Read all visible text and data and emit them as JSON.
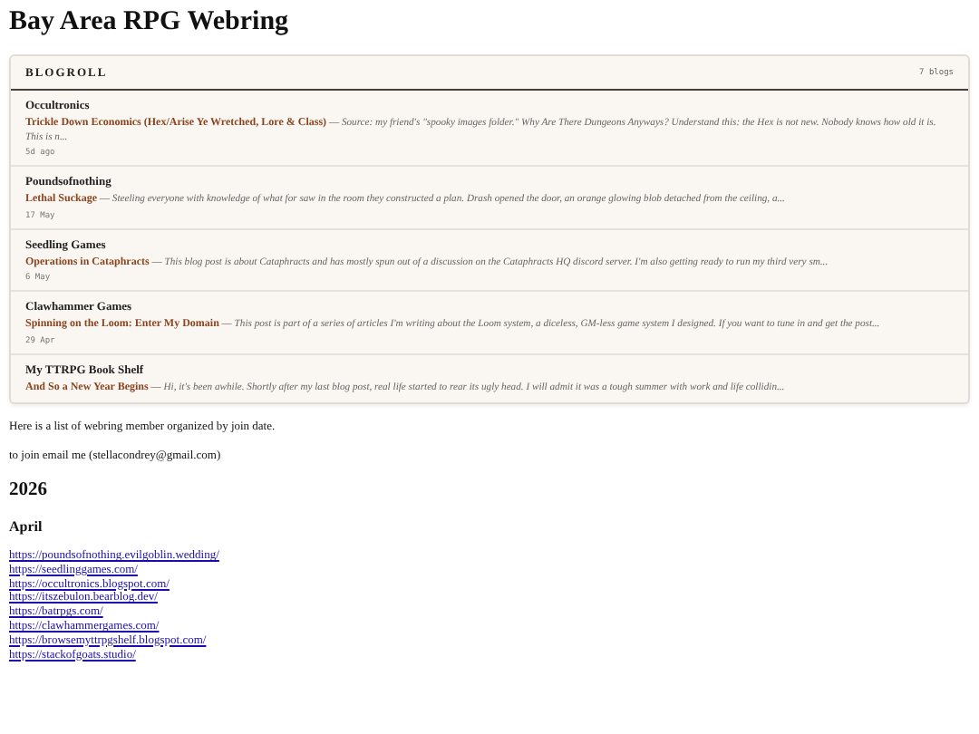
{
  "title": "Bay Area RPG Webring",
  "blogroll": {
    "heading": "BLOGROLL",
    "count": "7 blogs",
    "items": [
      {
        "blog": "Occultronics",
        "post": "Trickle Down Economics (Hex/Arise Ye Wretched, Lore & Class)",
        "separator": "—",
        "excerpt": "Source: my friend's \"spooky images folder.\"  Why Are There Dungeons Anyways?     Understand this: the Hex is not new. Nobody knows how old it is. This is n...",
        "date": "5d ago"
      },
      {
        "blog": "Poundsofnothing",
        "post": "Lethal Suckage",
        "separator": "—",
        "excerpt": "Steeling everyone with knowledge of what for saw in the room they constructed a plan. Drash opened the door, an orange glowing blob detached from the ceiling, a...",
        "date": "17 May"
      },
      {
        "blog": "Seedling Games",
        "post": "Operations in Cataphracts",
        "separator": "—",
        "excerpt": "This blog post is about Cataphracts and has mostly spun out of a discussion on the Cataphracts HQ discord server. I'm also getting ready to run my third very sm...",
        "date": "6 May"
      },
      {
        "blog": "Clawhammer Games",
        "post": "Spinning on the Loom: Enter My Domain",
        "separator": "—",
        "excerpt": "This post is part of a series of articles I'm writing about the Loom system, a diceless, GM-less game system I designed. If you want to tune in and get the post...",
        "date": "29 Apr"
      },
      {
        "blog": "My TTRPG Book Shelf",
        "post": "And So a New Year Begins",
        "separator": "—",
        "excerpt": "Hi, it's been awhile.  Shortly after my last blog post, real life started to rear its ugly head. I will admit it was a tough summer with work and life collidin..."
      }
    ]
  },
  "intro": "Here is a list of webring member organized by join date.",
  "join": "to join email me (stellacondrey@gmail.com)",
  "year": "2026",
  "month": "April",
  "links": [
    "https://poundsofnothing.evilgoblin.wedding/",
    "https://seedlinggames.com/",
    "https://occultronics.blogspot.com/",
    "https://itszebulon.bearblog.dev/",
    "https://batrpgs.com/",
    "https://clawhammergames.com/",
    "https://browsemyttrpgshelf.blogspot.com/",
    "https://stackofgoats.studio/"
  ]
}
